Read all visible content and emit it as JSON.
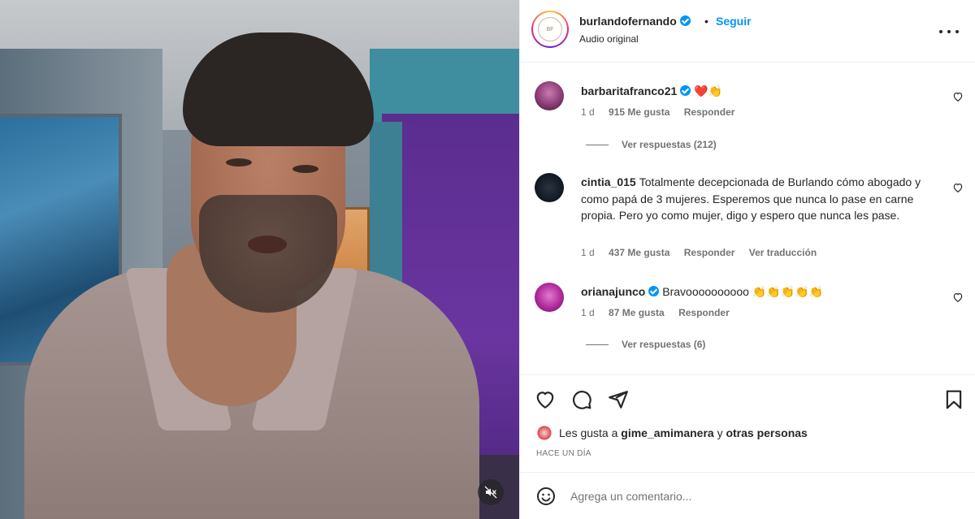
{
  "post": {
    "author": "burlandofernando",
    "follow_label": "Seguir",
    "dot": "•",
    "audio": "Audio original",
    "avatar_logo": "BF"
  },
  "comments": [
    {
      "username": "barbaritafranco21",
      "verified": true,
      "text": "❤️👏",
      "age": "1 d",
      "likes": "915 Me gusta",
      "reply_label": "Responder",
      "view_replies": "Ver respuestas (212)"
    },
    {
      "username": "cintia_015",
      "verified": false,
      "text": "Totalmente decepcionada de Burlando cómo abogado y como papá de 3 mujeres. Esperemos que nunca lo pase en carne propia. Pero yo como mujer, digo y espero que nunca les pase.",
      "age": "1 d",
      "likes": "437 Me gusta",
      "reply_label": "Responder",
      "translate_label": "Ver traducción"
    },
    {
      "username": "orianajunco",
      "verified": true,
      "text": "Bravoooooooooo 👏👏👏👏👏",
      "age": "1 d",
      "likes": "87 Me gusta",
      "reply_label": "Responder",
      "view_replies": "Ver respuestas (6)"
    }
  ],
  "likes_summary": {
    "prefix": "Les gusta a",
    "user": "gime_amimanera",
    "conj": "y",
    "others": "otras personas"
  },
  "timestamp": "HACE UN DÍA",
  "composer": {
    "placeholder": "Agrega un comentario..."
  },
  "icons": {
    "like": "heart-icon",
    "comment": "comment-icon",
    "share": "paper-plane-icon",
    "save": "bookmark-icon",
    "mute": "speaker-muted-icon",
    "emoji": "smiley-icon",
    "more": "ellipsis-icon"
  },
  "colors": {
    "accent": "#0095f6",
    "text": "#262626",
    "muted": "#737373"
  }
}
